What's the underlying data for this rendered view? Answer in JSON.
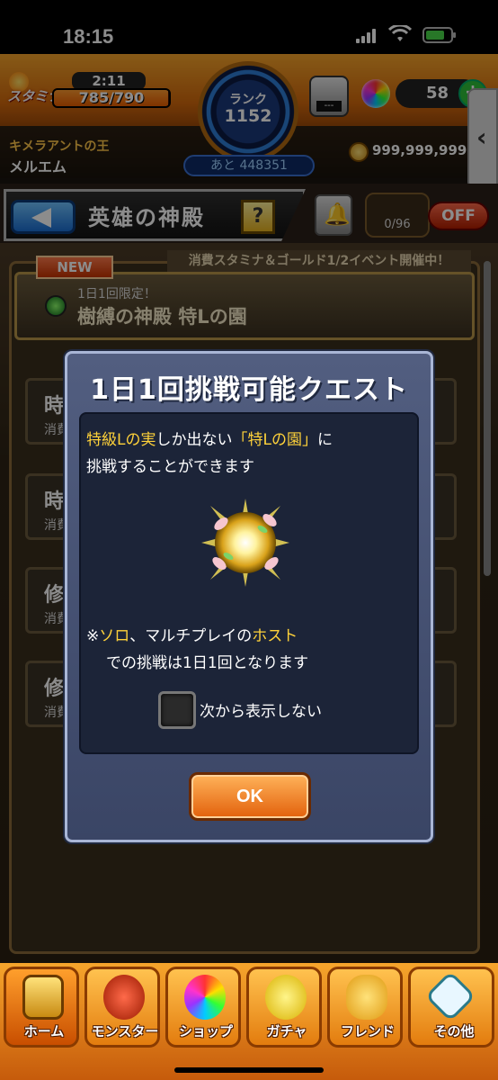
{
  "status": {
    "time": "18:15"
  },
  "header": {
    "stamina_label": "スタミナ",
    "stamina_timer": "2:11",
    "stamina_value": "785/790",
    "stamina_fraction": 0.9937,
    "rank_label": "ランク",
    "rank_value": "1152",
    "rank_next": "あと 448351",
    "robot_screen": "---",
    "orb_count": "58",
    "orb_plus": "+",
    "guild_title": "キメラアントの王",
    "player_name": "メルエム",
    "gold_value": "999,999,999+",
    "side_tab_icon": "chevron-left-icon"
  },
  "page": {
    "title": "英雄の神殿",
    "help_label": "?",
    "counter": "0/96",
    "toggle": "OFF"
  },
  "list": {
    "new_badge": "NEW",
    "event_banner": "消費スタミナ＆ゴールド1/2イベント開催中！",
    "featured": {
      "sub": "1日1回限定！",
      "name": "樹縛の神殿 特Lの園"
    },
    "cards": [
      {
        "t1": "時",
        "t2": "消費"
      },
      {
        "t1": "時",
        "t2": "消費"
      },
      {
        "t1": "修",
        "t2": "消費"
      },
      {
        "t1": "修",
        "t2": "消費"
      }
    ]
  },
  "dialog": {
    "title": "1日1回挑戦可能クエスト",
    "line1_a": "特級Lの実",
    "line1_b": "しか出ない",
    "line1_c": "「特Lの園」",
    "line1_d": "に",
    "line2": "挑戦することができます",
    "note1_a": "※",
    "note1_b": "ソロ",
    "note1_c": "、マルチプレイの",
    "note1_d": "ホスト",
    "note2": "での挑戦は1日1回となります",
    "checkbox_label": "次から表示しない",
    "ok": "OK"
  },
  "nav": {
    "items": [
      {
        "label": "ホーム",
        "icon": "home-icon"
      },
      {
        "label": "モンスター",
        "icon": "monster-icon"
      },
      {
        "label": "ショップ",
        "icon": "orb-icon"
      },
      {
        "label": "ガチャ",
        "icon": "gacha-icon"
      },
      {
        "label": "フレンド",
        "icon": "friend-icon"
      },
      {
        "label": "その他",
        "icon": "other-icon"
      }
    ]
  }
}
